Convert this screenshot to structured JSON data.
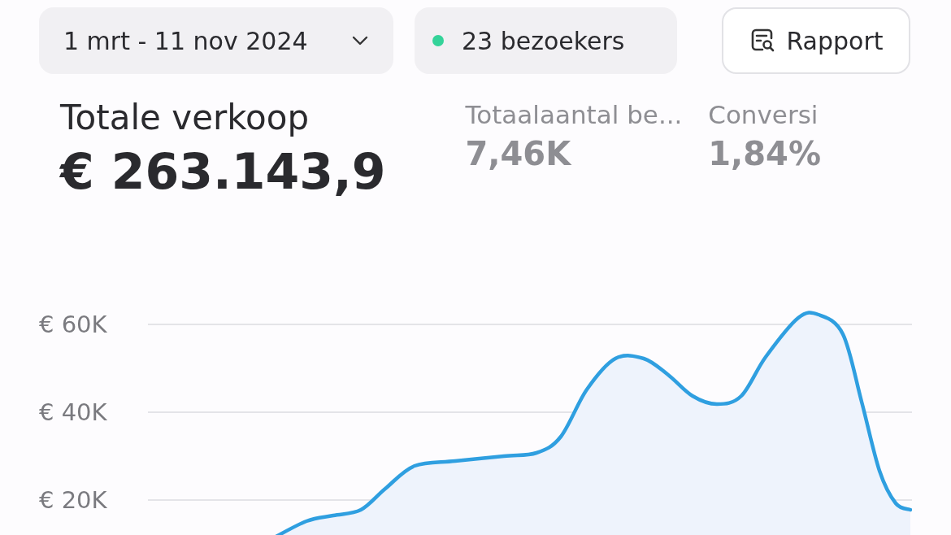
{
  "toolbar": {
    "date_range": "1 mrt - 11 nov 2024",
    "visitors": {
      "text": "23 bezoekers",
      "color": "#34d399"
    },
    "report_button": "Rapport"
  },
  "total_sales": {
    "label": "Totale verkoop",
    "value": "€ 263.143,9"
  },
  "stats": [
    {
      "label": "Totaalaantal be...",
      "value": "7,46K"
    },
    {
      "label": "Conversi",
      "value": "1,84%"
    }
  ],
  "chart": {
    "y_labels": [
      "€ 60K",
      "€ 40K",
      "€ 20K"
    ]
  }
}
